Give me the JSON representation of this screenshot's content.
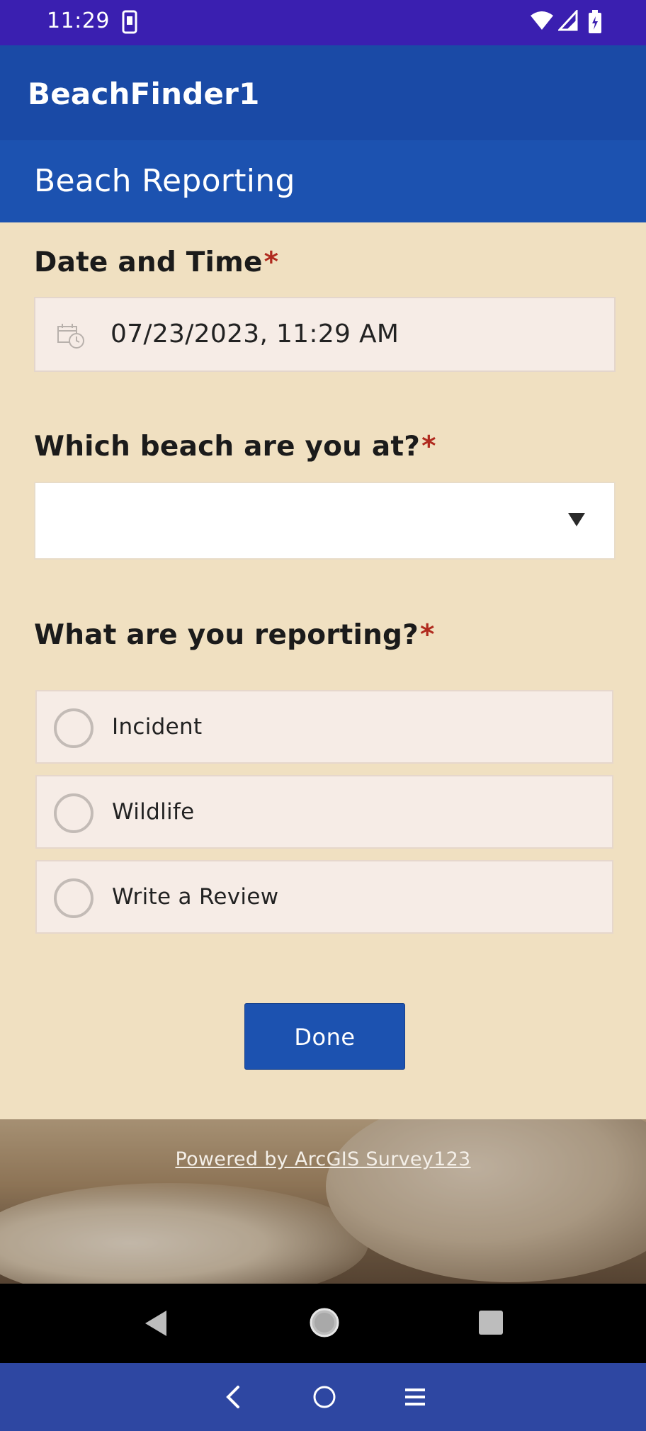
{
  "status_bar": {
    "time": "11:29"
  },
  "app_bar": {
    "title": "BeachFinder1"
  },
  "survey": {
    "title": "Beach Reporting",
    "questions": {
      "date_time": {
        "label": "Date and Time",
        "required_mark": "*",
        "value": "07/23/2023, 11:29 AM"
      },
      "beach": {
        "label": "Which beach are you at?",
        "required_mark": "*",
        "value": ""
      },
      "reporting": {
        "label": "What are you reporting?",
        "required_mark": "*",
        "options": [
          "Incident",
          "Wildlife",
          "Write a Review"
        ]
      }
    },
    "done_label": "Done"
  },
  "footer": {
    "powered_by": "Powered by ArcGIS Survey123"
  },
  "colors": {
    "app_bar": "#1a4aa6",
    "header": "#1c52b0",
    "form_background": "#f0e0c1",
    "required": "#b02a1e"
  }
}
